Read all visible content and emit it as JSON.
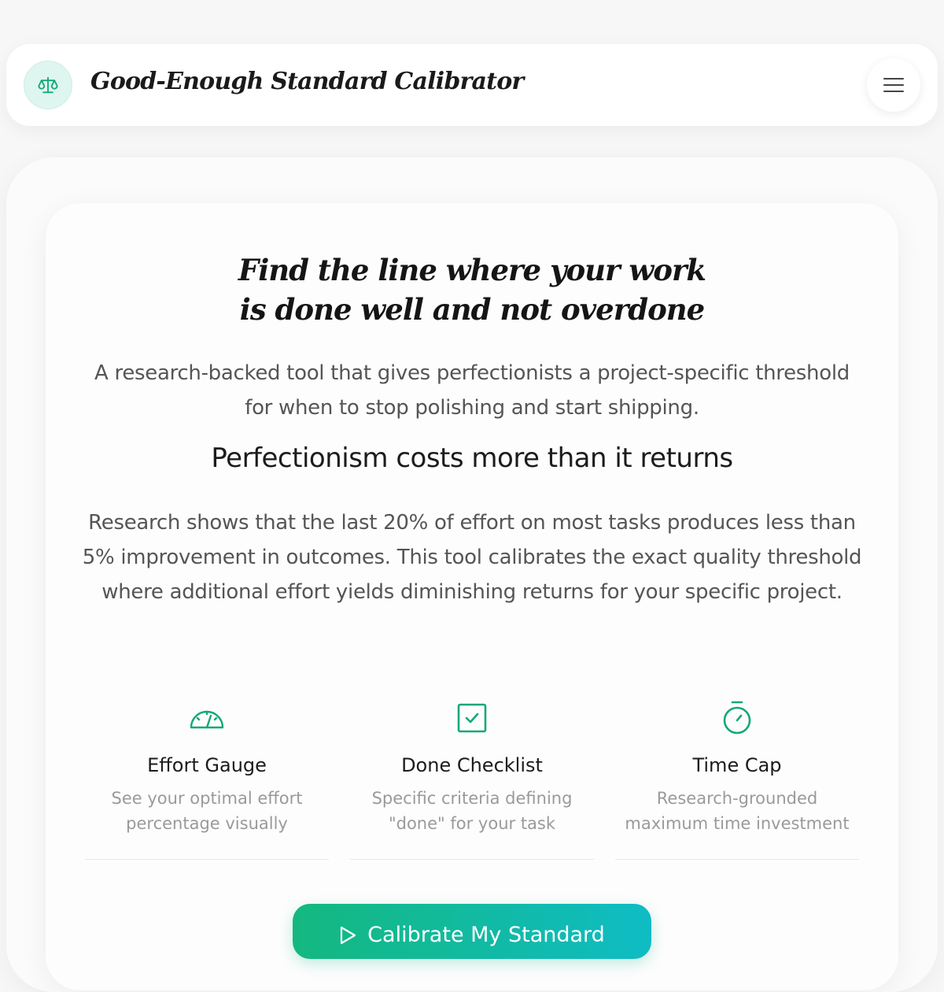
{
  "header": {
    "title": "Good-Enough Standard Calibrator",
    "logo_icon": "scale-icon",
    "menu_icon": "hamburger-menu-icon"
  },
  "hero": {
    "title_line1": "Find the line where your work",
    "title_line2": "is done well and not overdone",
    "subtitle": "A research-backed tool that gives perfectionists a project-specific threshold for when to stop polishing and start shipping."
  },
  "section": {
    "title": "Perfectionism costs more than it returns",
    "body": "Research shows that the last 20% of effort on most tasks produces less than 5% improvement in outcomes. This tool calibrates the exact quality threshold where additional effort yields diminishing returns for your specific project."
  },
  "features": [
    {
      "icon": "gauge-icon",
      "title": "Effort Gauge",
      "desc": "See your optimal effort percentage visually"
    },
    {
      "icon": "checkbox-icon",
      "title": "Done Checklist",
      "desc": "Specific criteria defining \"done\" for your task"
    },
    {
      "icon": "stopwatch-icon",
      "title": "Time Cap",
      "desc": "Research-grounded maximum time investment"
    }
  ],
  "cta": {
    "label": "Calibrate My Standard",
    "icon": "play-icon"
  },
  "colors": {
    "accent": "#14a87a",
    "gradient_start": "#14b87e",
    "gradient_end": "#0fbcc4",
    "logo_bg": "#dff5ef"
  }
}
